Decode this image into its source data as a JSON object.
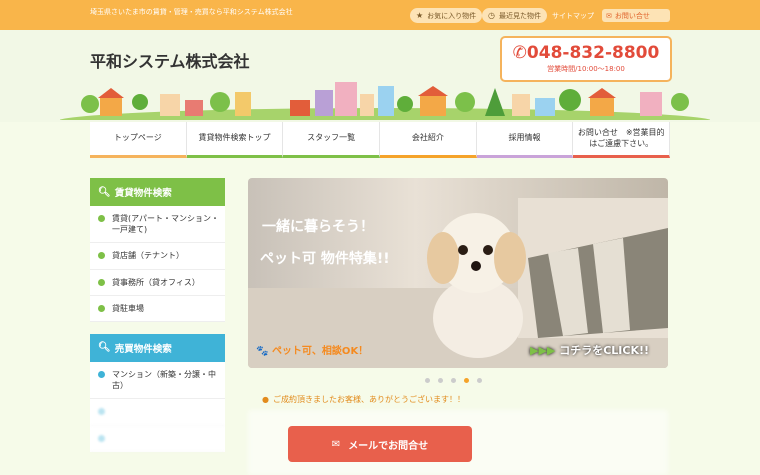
{
  "topbar": {
    "tagline": "埼玉県さいたま市の賃貸・管理・売買なら平和システム株式会社",
    "favorites": "お気に入り物件",
    "recent": "最近見た物件",
    "sitemap": "サイトマップ",
    "contact": "お問い合せ"
  },
  "header": {
    "logo": "平和システム株式会社",
    "phone": "048-832-8800",
    "hours": "営業時間/10:00〜18:00"
  },
  "nav": [
    {
      "label": "トップページ",
      "color": "#f5b35c"
    },
    {
      "label": "賃貸物件検索トップ",
      "color": "#7ec047"
    },
    {
      "label": "スタッフ一覧",
      "color": "#7ec047"
    },
    {
      "label": "会社紹介",
      "color": "#f5a32a"
    },
    {
      "label": "採用情報",
      "color": "#c9a3d9"
    },
    {
      "label": "お問い合せ　※営業目的はご遠慮下さい。",
      "color": "#e8604c"
    }
  ],
  "sidebar": {
    "rent_title": "賃貸物件検索",
    "rent_items": [
      "賃貸(アパート・マンション・一戸建て)",
      "貸店舗（テナント）",
      "貸事務所（貸オフィス）",
      "貸駐車場"
    ],
    "sale_title": "売買物件検索",
    "sale_items": [
      "マンション（新築・分譲・中古）"
    ]
  },
  "slider": {
    "line1": "一緒に暮らそう！",
    "line2": "ペット可 物件特集!!",
    "tag": "ペット可、相談OK！",
    "cta": "コチラをCLICK!!",
    "dots": 5,
    "active": 3
  },
  "notice": "ご成約頂きましたお客様、ありがとうございます！！",
  "mail_button": "メールでお問合せ",
  "icons": [
    "star-icon",
    "clock-icon",
    "mail-icon",
    "phone-icon",
    "search-icon",
    "arrow-icon",
    "paw-icon"
  ]
}
